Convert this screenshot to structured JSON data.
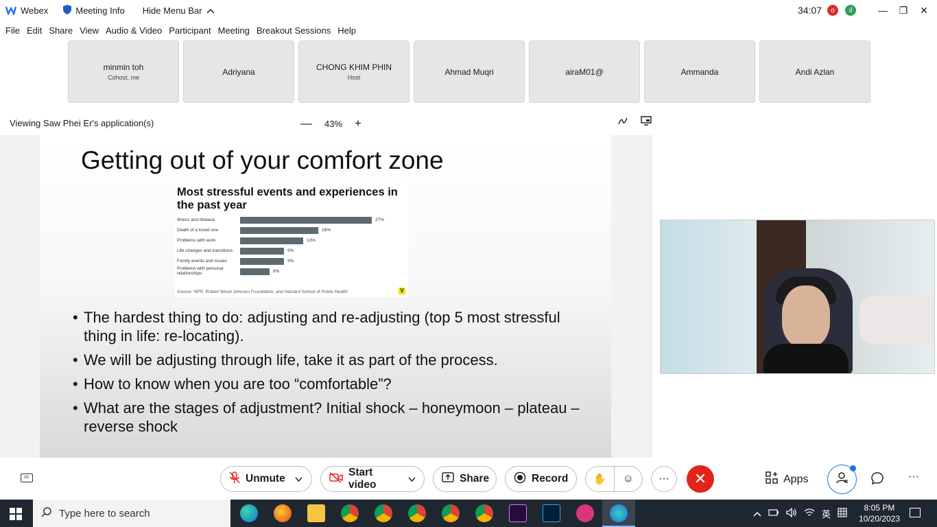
{
  "titlebar": {
    "app_name": "Webex",
    "meeting_info": "Meeting Info",
    "hide_menu": "Hide Menu Bar",
    "timer": "34:07",
    "rec_badge": "o",
    "stats_badge": "ıl"
  },
  "menu": [
    "File",
    "Edit",
    "Share",
    "View",
    "Audio & Video",
    "Participant",
    "Meeting",
    "Breakout Sessions",
    "Help"
  ],
  "participants": [
    {
      "name": "minmin toh",
      "role": "Cohost, me"
    },
    {
      "name": "Adriyana",
      "role": ""
    },
    {
      "name": "CHONG KHIM PHIN",
      "role": "Host"
    },
    {
      "name": "Ahmad Muqri",
      "role": ""
    },
    {
      "name": "airaM01@",
      "role": ""
    },
    {
      "name": "Ammanda",
      "role": ""
    },
    {
      "name": "Andi Azlan",
      "role": ""
    }
  ],
  "view": {
    "viewing_text": "Viewing Saw Phei Er's application(s)",
    "zoom_level": "43%",
    "zoom_out": "—",
    "zoom_in": "+"
  },
  "slide": {
    "title": "Getting out of your comfort zone",
    "bullets": [
      "The hardest thing to do: adjusting and re-adjusting (top 5 most stressful thing in life: re-locating).",
      "We will be adjusting through life, take it as part of the process.",
      "How to know when you are too “comfortable”?",
      "What are the stages of adjustment? Initial shock – honeymoon – plateau – reverse shock"
    ]
  },
  "chart_data": {
    "type": "bar",
    "orientation": "horizontal",
    "title": "Most stressful events and experiences in the past year",
    "categories": [
      "Illness and disease",
      "Death of a loved one",
      "Problems with work",
      "Life changes and transitions",
      "Family events and issues",
      "Problems with personal relationships"
    ],
    "values": [
      27,
      16,
      13,
      9,
      9,
      6
    ],
    "value_labels": [
      "27%",
      "16%",
      "13%",
      "9%",
      "9%",
      "6%"
    ],
    "xlim": [
      0,
      30
    ],
    "source": "Source: NPR, Robert Wood Johnson Foundation, and Harvard School of Public Health",
    "brand_mark": "V",
    "bar_color": "#5d6b70"
  },
  "controls": {
    "unmute": "Unmute",
    "start_video": "Start video",
    "share": "Share",
    "record": "Record",
    "apps": "Apps",
    "more": "···",
    "leave_icon": "✕",
    "leave_color": "#e2231a"
  },
  "taskbar": {
    "search_placeholder": "Type here to search",
    "time": "8:05 PM",
    "date": "10/20/2023",
    "ime_label": "英"
  }
}
